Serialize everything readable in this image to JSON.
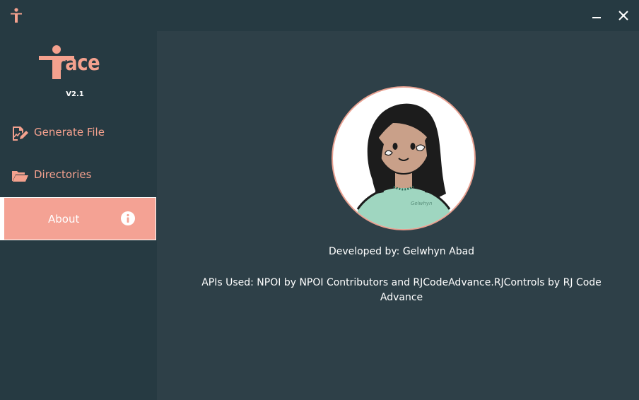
{
  "app": {
    "logo_text": "race",
    "version": "V2.1"
  },
  "window_controls": {
    "minimize_glyph": "–",
    "close_glyph": "✕"
  },
  "sidebar": {
    "items": [
      {
        "label": "Generate File",
        "icon": "document-edit-icon"
      },
      {
        "label": "Directories",
        "icon": "folder-open-icon"
      },
      {
        "label": "About",
        "icon": "info-icon",
        "active": true
      }
    ]
  },
  "about": {
    "avatar": "developer-avatar",
    "avatar_signature": "Gelwhyn",
    "developed_by": "Developed by: Gelwhyn Abad",
    "apis_used": "APIs Used: NPOI by NPOI Contributors and RJCodeAdvance.RJControls by RJ Code Advance"
  },
  "colors": {
    "background": "#263a42",
    "content": "#2e4048",
    "accent": "#f4a18e",
    "active_item": "#f4a294",
    "text": "#ffffff"
  }
}
